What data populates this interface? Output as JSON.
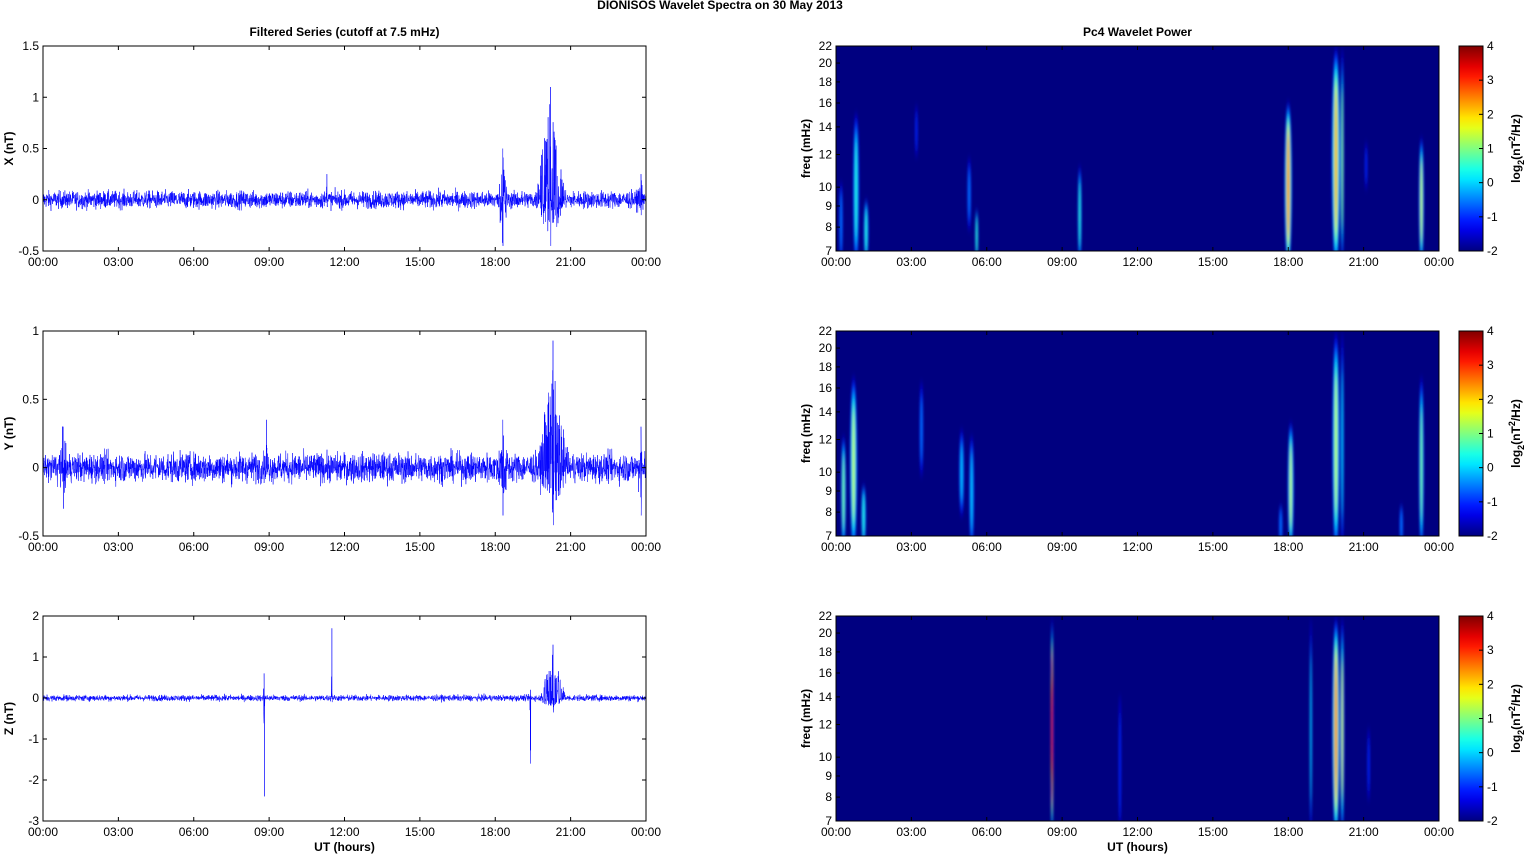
{
  "title": "DIONISOS Wavelet Spectra on 30 May      2013",
  "chart_data": [
    {
      "type": "line",
      "title": "Filtered Series (cutoff at 7.5 mHz)",
      "ylabel": "X (nT)",
      "xlabel": "",
      "xlim": [
        0,
        24
      ],
      "ylim": [
        -0.5,
        1.5
      ],
      "yticks": [
        "-0.5",
        "0",
        "0.5",
        "1",
        "1.5"
      ],
      "yticks_values": [
        -0.5,
        0,
        0.5,
        1,
        1.5
      ],
      "noise_amplitude_nT": 0.08,
      "events": [
        {
          "hour": 11.3,
          "max": 0.25,
          "min": -0.05,
          "duration_h": 0.05
        },
        {
          "hour": 18.3,
          "max": 0.5,
          "min": -0.45,
          "duration_h": 0.4
        },
        {
          "hour": 20.2,
          "max": 1.1,
          "min": -0.45,
          "duration_h": 1.2
        },
        {
          "hour": 23.8,
          "max": 0.25,
          "min": -0.15,
          "duration_h": 0.3
        }
      ]
    },
    {
      "type": "line",
      "title": "",
      "ylabel": "Y (nT)",
      "xlabel": "",
      "xlim": [
        0,
        24
      ],
      "ylim": [
        -0.5,
        1
      ],
      "yticks": [
        "-0.5",
        "0",
        "0.5",
        "1"
      ],
      "yticks_values": [
        -0.5,
        0,
        0.5,
        1
      ],
      "noise_amplitude_nT": 0.1,
      "events": [
        {
          "hour": 0.8,
          "max": 0.3,
          "min": -0.3,
          "duration_h": 0.6
        },
        {
          "hour": 8.9,
          "max": 0.35,
          "min": -0.05,
          "duration_h": 0.05
        },
        {
          "hour": 18.3,
          "max": 0.35,
          "min": -0.35,
          "duration_h": 0.4
        },
        {
          "hour": 20.3,
          "max": 0.93,
          "min": -0.42,
          "duration_h": 1.2
        },
        {
          "hour": 23.8,
          "max": 0.3,
          "min": -0.35,
          "duration_h": 0.3
        }
      ]
    },
    {
      "type": "line",
      "title": "",
      "ylabel": "Z (nT)",
      "xlabel": "UT (hours)",
      "xlim": [
        0,
        24
      ],
      "ylim": [
        -3,
        2
      ],
      "yticks": [
        "-3",
        "-2",
        "-1",
        "0",
        "1",
        "2"
      ],
      "yticks_values": [
        -3,
        -2,
        -1,
        0,
        1,
        2
      ],
      "noise_amplitude_nT": 0.07,
      "events": [
        {
          "hour": 8.8,
          "max": 0.6,
          "min": -2.4,
          "duration_h": 0.04
        },
        {
          "hour": 11.5,
          "max": 1.7,
          "min": -0.1,
          "duration_h": 0.03
        },
        {
          "hour": 19.4,
          "max": 0.2,
          "min": -1.6,
          "duration_h": 0.04
        },
        {
          "hour": 20.3,
          "max": 1.3,
          "min": -0.35,
          "duration_h": 1.0
        }
      ]
    },
    {
      "type": "heatmap",
      "title": "Pc4 Wavelet Power",
      "ylabel": "freq (mHz)",
      "xlabel": "",
      "xlim": [
        0,
        24
      ],
      "ylim": [
        7,
        22
      ],
      "yscale": "log",
      "yticks": [
        "7",
        "8",
        "9",
        "10",
        "12",
        "14",
        "16",
        "18",
        "20",
        "22"
      ],
      "yticks_values": [
        7,
        8,
        9,
        10,
        12,
        14,
        16,
        18,
        20,
        22
      ],
      "colorbar": {
        "label": "log2(nT2/Hz)",
        "range": [
          -2,
          4
        ],
        "ticks": [
          "-2",
          "-1",
          "0",
          "1",
          "2",
          "3",
          "4"
        ]
      },
      "background_log2": -2,
      "events": [
        {
          "hour": 0.2,
          "fmin": 7,
          "fmax": 10,
          "peak": -0.5,
          "width_h": 0.15
        },
        {
          "hour": 0.8,
          "fmin": 7,
          "fmax": 15,
          "peak": 0.5,
          "width_h": 0.25
        },
        {
          "hour": 1.2,
          "fmin": 7,
          "fmax": 9,
          "peak": 0.5,
          "width_h": 0.2
        },
        {
          "hour": 3.2,
          "fmin": 12,
          "fmax": 16,
          "peak": -1,
          "width_h": 0.1
        },
        {
          "hour": 5.3,
          "fmin": 8,
          "fmax": 12,
          "peak": -0.5,
          "width_h": 0.15
        },
        {
          "hour": 5.6,
          "fmin": 7,
          "fmax": 8.5,
          "peak": 0.5,
          "width_h": 0.12
        },
        {
          "hour": 9.7,
          "fmin": 7,
          "fmax": 11,
          "peak": 0.5,
          "width_h": 0.15
        },
        {
          "hour": 18.0,
          "fmin": 7,
          "fmax": 16,
          "peak": 3,
          "width_h": 0.3
        },
        {
          "hour": 19.9,
          "fmin": 7,
          "fmax": 22,
          "peak": 2.3,
          "width_h": 0.35
        },
        {
          "hour": 20.15,
          "fmin": 7,
          "fmax": 22,
          "peak": 0.8,
          "width_h": 0.12
        },
        {
          "hour": 21.1,
          "fmin": 10,
          "fmax": 13,
          "peak": -1,
          "width_h": 0.1
        },
        {
          "hour": 23.3,
          "fmin": 7,
          "fmax": 13,
          "peak": 1.5,
          "width_h": 0.2
        }
      ]
    },
    {
      "type": "heatmap",
      "title": "",
      "ylabel": "freq (mHz)",
      "xlabel": "",
      "xlim": [
        0,
        24
      ],
      "ylim": [
        7,
        22
      ],
      "yscale": "log",
      "yticks": [
        "7",
        "8",
        "9",
        "10",
        "12",
        "14",
        "16",
        "18",
        "20",
        "22"
      ],
      "yticks_values": [
        7,
        8,
        9,
        10,
        12,
        14,
        16,
        18,
        20,
        22
      ],
      "colorbar": {
        "label": "log2(nT2/Hz)",
        "range": [
          -2,
          4
        ],
        "ticks": [
          "-2",
          "-1",
          "0",
          "1",
          "2",
          "3",
          "4"
        ]
      },
      "background_log2": -2,
      "events": [
        {
          "hour": 0.3,
          "fmin": 7,
          "fmax": 12,
          "peak": 1,
          "width_h": 0.2
        },
        {
          "hour": 0.7,
          "fmin": 7,
          "fmax": 17,
          "peak": 1.5,
          "width_h": 0.3
        },
        {
          "hour": 1.1,
          "fmin": 7,
          "fmax": 9,
          "peak": 0.5,
          "width_h": 0.2
        },
        {
          "hour": 3.4,
          "fmin": 10,
          "fmax": 17,
          "peak": -0.5,
          "width_h": 0.15
        },
        {
          "hour": 5.0,
          "fmin": 8,
          "fmax": 13,
          "peak": 0,
          "width_h": 0.2
        },
        {
          "hour": 5.4,
          "fmin": 7,
          "fmax": 12,
          "peak": 0,
          "width_h": 0.2
        },
        {
          "hour": 17.7,
          "fmin": 7,
          "fmax": 8,
          "peak": -0.5,
          "width_h": 0.15
        },
        {
          "hour": 18.1,
          "fmin": 7,
          "fmax": 13,
          "peak": 1.5,
          "width_h": 0.25
        },
        {
          "hour": 19.9,
          "fmin": 7,
          "fmax": 22,
          "peak": 1.5,
          "width_h": 0.3
        },
        {
          "hour": 20.15,
          "fmin": 7,
          "fmax": 22,
          "peak": 0,
          "width_h": 0.12
        },
        {
          "hour": 22.5,
          "fmin": 7,
          "fmax": 8,
          "peak": -0.5,
          "width_h": 0.15
        },
        {
          "hour": 23.3,
          "fmin": 7,
          "fmax": 17,
          "peak": 1,
          "width_h": 0.2
        }
      ]
    },
    {
      "type": "heatmap",
      "title": "",
      "ylabel": "freq (mHz)",
      "xlabel": "UT (hours)",
      "xlim": [
        0,
        24
      ],
      "ylim": [
        7,
        22
      ],
      "yscale": "log",
      "yticks": [
        "7",
        "8",
        "9",
        "10",
        "12",
        "14",
        "16",
        "18",
        "20",
        "22"
      ],
      "yticks_values": [
        7,
        8,
        9,
        10,
        12,
        14,
        16,
        18,
        20,
        22
      ],
      "colorbar": {
        "label": "log2(nT2/Hz)",
        "range": [
          -2,
          4
        ],
        "ticks": [
          "-2",
          "-1",
          "0",
          "1",
          "2",
          "3",
          "4"
        ]
      },
      "background_log2": -2,
      "events": [
        {
          "hour": 8.6,
          "fmin": 7,
          "fmax": 22,
          "peak": 3.3,
          "width_h": 0.1
        },
        {
          "hour": 11.3,
          "fmin": 7,
          "fmax": 14,
          "peak": -1,
          "width_h": 0.1
        },
        {
          "hour": 18.9,
          "fmin": 7,
          "fmax": 22,
          "peak": 0,
          "width_h": 0.08
        },
        {
          "hour": 19.9,
          "fmin": 7,
          "fmax": 22,
          "peak": 3,
          "width_h": 0.3
        },
        {
          "hour": 20.15,
          "fmin": 7,
          "fmax": 22,
          "peak": 1.5,
          "width_h": 0.15
        },
        {
          "hour": 21.2,
          "fmin": 8,
          "fmax": 12,
          "peak": -1,
          "width_h": 0.1
        }
      ]
    }
  ],
  "xticks": [
    "00:00",
    "03:00",
    "06:00",
    "09:00",
    "12:00",
    "15:00",
    "18:00",
    "21:00",
    "00:00"
  ],
  "colors": {
    "line": "#0000ff",
    "background": "#00008f"
  }
}
